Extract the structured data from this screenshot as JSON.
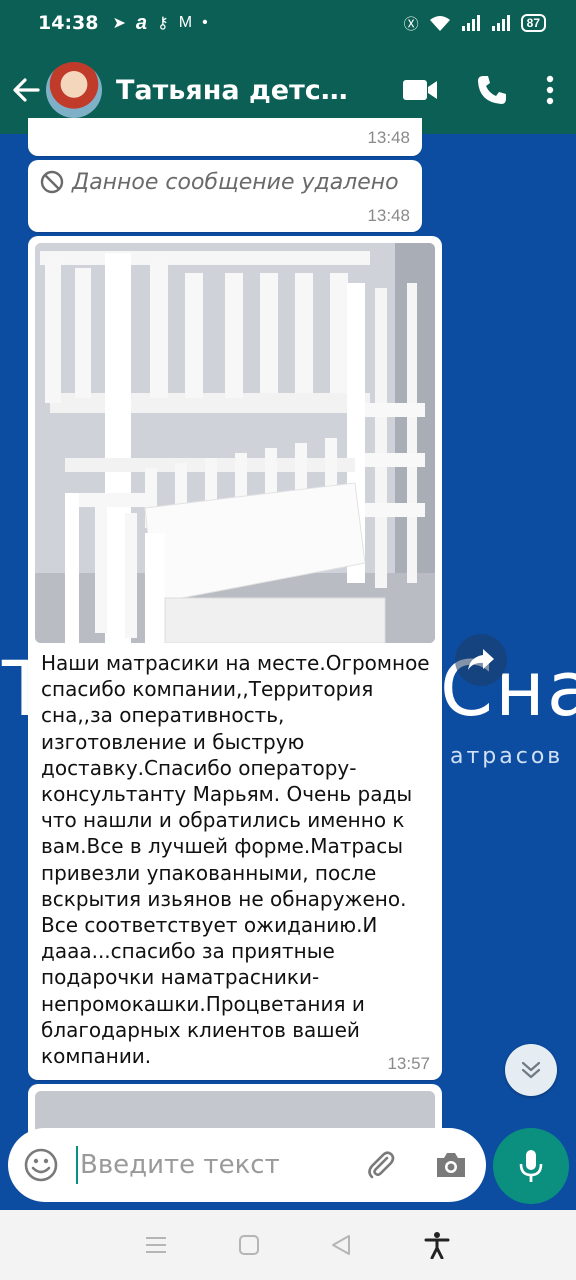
{
  "status_bar": {
    "time": "14:38",
    "battery": "87"
  },
  "header": {
    "contact_name": "Татьяна детски...",
    "colors": {
      "bar": "#0b5f54",
      "accent": "#0b8f7f"
    }
  },
  "wallpaper": {
    "brand_left": "T",
    "brand_right": "Сна",
    "tagline": "атрасов"
  },
  "messages": [
    {
      "type": "partial",
      "time": "13:48"
    },
    {
      "type": "deleted",
      "text": "Данное сообщение удалено",
      "time": "13:48"
    },
    {
      "type": "image",
      "image_description": "white wooden bunk bed",
      "caption": "Наши матрасики на месте.Огромное спасибо компании,,Территория сна,,за оперативность, изготовление и быструю доставку.Спасибо оператору-консультанту Марьям. Очень рады что нашли и обратились именно к вам.Все в лучшей форме.Матрасы привезли упакованными, после вскрытия изьянов не обнаружено. Все соответствует ожиданию.И дааа...спасибо за приятные подарочки наматрасники-непромокашки.Процветания и благодарных клиентов вашей компании.",
      "time": "13:57"
    }
  ],
  "input": {
    "placeholder": "Введите текст"
  },
  "icons": [
    "back-arrow-icon",
    "video-call-icon",
    "phone-icon",
    "more-vert-icon",
    "forward-icon",
    "chevron-double-down-icon",
    "emoji-icon",
    "paperclip-icon",
    "camera-icon",
    "mic-icon",
    "menu-icon",
    "home-square-icon",
    "back-triangle-icon",
    "accessibility-icon"
  ]
}
